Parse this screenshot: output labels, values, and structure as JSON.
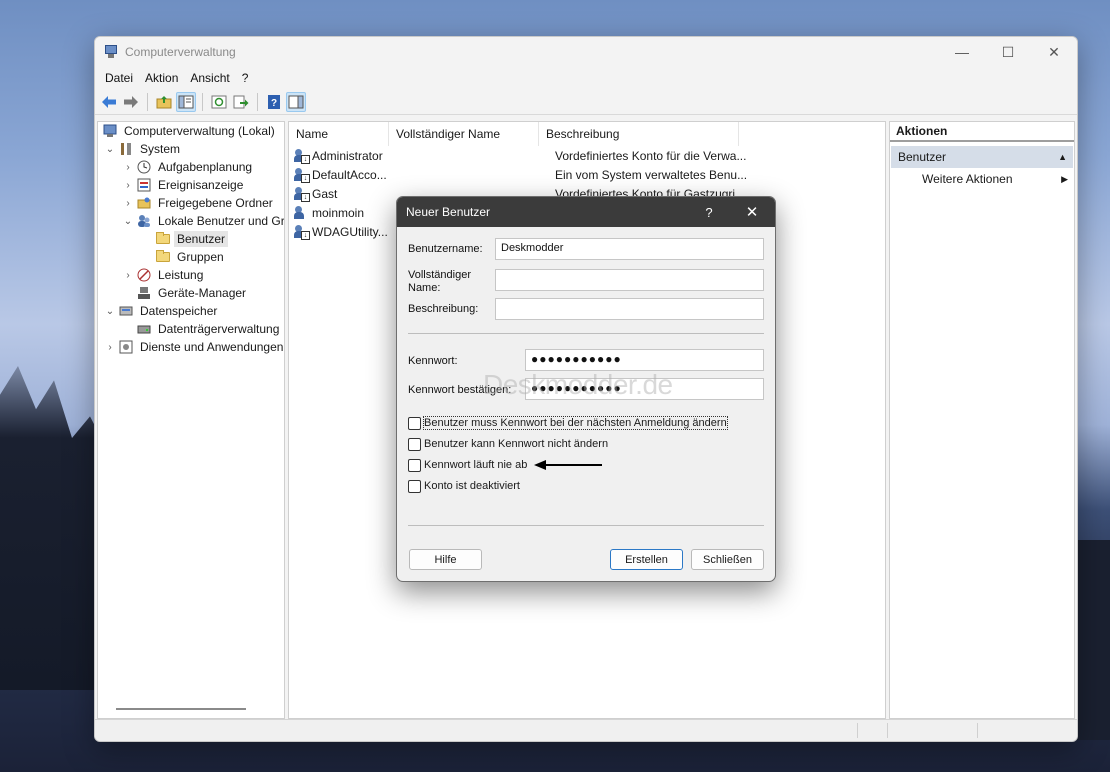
{
  "window": {
    "title": "Computerverwaltung",
    "controls": {
      "minimize": "—",
      "maximize": "☐",
      "close": "✕"
    }
  },
  "menu": [
    {
      "label": "Datei"
    },
    {
      "label": "Aktion"
    },
    {
      "label": "Ansicht"
    },
    {
      "label": "?"
    }
  ],
  "tree": {
    "items": [
      {
        "label": "Computerverwaltung (Lokal)",
        "icon": "computer-management-icon"
      },
      {
        "label": "System",
        "icon": "tools-icon",
        "toggle": "⌄"
      },
      {
        "label": "Aufgabenplanung",
        "icon": "clock-icon",
        "toggle": "›"
      },
      {
        "label": "Ereignisanzeige",
        "icon": "event-viewer-icon",
        "toggle": "›"
      },
      {
        "label": "Freigegebene Ordner",
        "icon": "shared-folder-icon",
        "toggle": "›"
      },
      {
        "label": "Lokale Benutzer und Gr",
        "icon": "users-icon",
        "toggle": "⌄"
      },
      {
        "label": "Benutzer",
        "icon": "folder-icon"
      },
      {
        "label": "Gruppen",
        "icon": "folder-icon"
      },
      {
        "label": "Leistung",
        "icon": "performance-icon",
        "toggle": "›"
      },
      {
        "label": "Geräte-Manager",
        "icon": "device-manager-icon"
      },
      {
        "label": "Datenspeicher",
        "icon": "storage-icon",
        "toggle": "⌄"
      },
      {
        "label": "Datenträgerverwaltung",
        "icon": "disk-icon"
      },
      {
        "label": "Dienste und Anwendungen",
        "icon": "services-icon",
        "toggle": "›"
      }
    ]
  },
  "list": {
    "columns": [
      "Name",
      "Vollständiger Name",
      "Beschreibung"
    ],
    "rows": [
      {
        "name": "Administrator",
        "fullname": "",
        "description": "Vordefiniertes Konto für die Verwa..."
      },
      {
        "name": "DefaultAcco...",
        "fullname": "",
        "description": "Ein vom System verwaltetes Benu..."
      },
      {
        "name": "Gast",
        "fullname": "",
        "description": "Vordefiniertes Konto für Gastzugri..."
      },
      {
        "name": "moinmoin",
        "fullname": "",
        "description": ""
      },
      {
        "name": "WDAGUtility...",
        "fullname": "",
        "description": ""
      }
    ]
  },
  "actions": {
    "title": "Aktionen",
    "section": "Benutzer",
    "item": "Weitere Aktionen"
  },
  "dialog": {
    "title": "Neuer Benutzer",
    "help_glyph": "?",
    "close_glyph": "✕",
    "username_label": "Benutzername:",
    "username_value": "Deskmodder",
    "fullname_label_1": "Vollständiger",
    "fullname_label_2": "Name:",
    "fullname_value": "",
    "description_label": "Beschreibung:",
    "description_value": "",
    "password_label": "Kennwort:",
    "password_value": "●●●●●●●●●●●",
    "confirm_label": "Kennwort bestätigen:",
    "confirm_value": "●●●●●●●●●●●",
    "checkboxes": [
      {
        "label": "Benutzer muss Kennwort bei der nächsten Anmeldung ändern",
        "checked": false
      },
      {
        "label": "Benutzer kann Kennwort nicht ändern",
        "checked": false
      },
      {
        "label": "Kennwort läuft nie ab",
        "checked": false
      },
      {
        "label": "Konto ist deaktiviert",
        "checked": false
      }
    ],
    "help_button": "Hilfe",
    "create_button": "Erstellen",
    "close_button": "Schließen",
    "watermark": "Deskmodder.de"
  }
}
